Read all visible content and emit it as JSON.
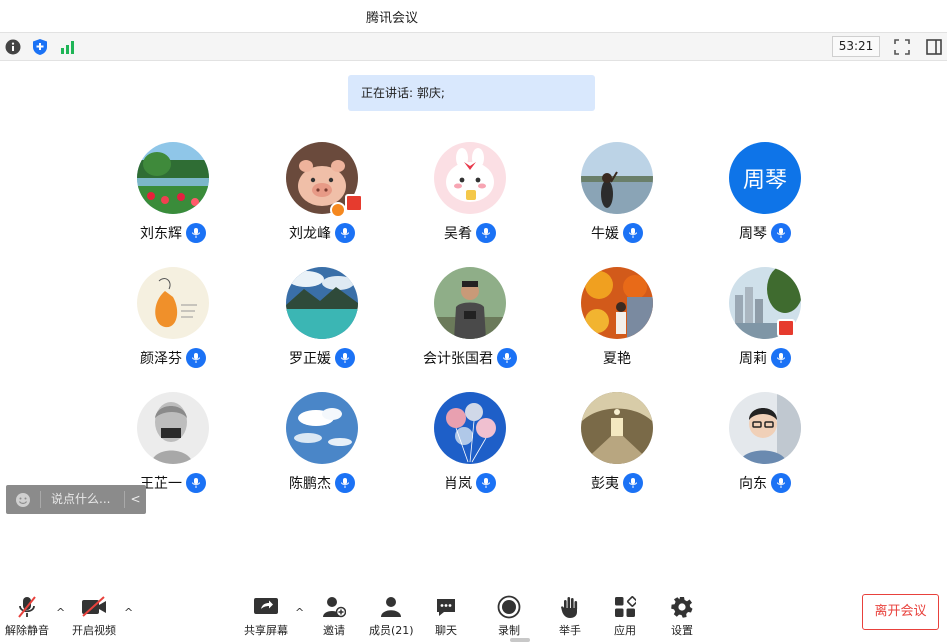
{
  "window": {
    "title": "腾讯会议"
  },
  "infobar": {
    "info_icon": "info-icon",
    "security_icon": "shield-icon",
    "signal_icon": "signal-icon",
    "timer": "53:21",
    "fullscreen_icon": "fullscreen-icon",
    "sidebar_icon": "sidebar-toggle-icon"
  },
  "speaking": {
    "text": "正在讲话: 郭庆;"
  },
  "participants": [
    {
      "name": "刘东辉",
      "avatar": "garden"
    },
    {
      "name": "刘龙峰",
      "avatar": "pig"
    },
    {
      "name": "吴肴",
      "avatar": "bunny"
    },
    {
      "name": "牛媛",
      "avatar": "lake-person"
    },
    {
      "name": "周琴",
      "avatar_text": "周琴",
      "avatar": "text"
    },
    {
      "name": "颜泽芬",
      "avatar": "sketch-balloon"
    },
    {
      "name": "罗正媛",
      "avatar": "mountain-lake"
    },
    {
      "name": "会计张国君",
      "avatar": "hiker"
    },
    {
      "name": "夏艳",
      "avatar": "autumn"
    },
    {
      "name": "周莉",
      "avatar": "city"
    },
    {
      "name": "王芷一",
      "avatar": "statue"
    },
    {
      "name": "陈鹏杰",
      "avatar": "clouds"
    },
    {
      "name": "肖岚",
      "avatar": "balloons"
    },
    {
      "name": "彭夷",
      "avatar": "metro"
    },
    {
      "name": "向东",
      "avatar": "glasses-man"
    }
  ],
  "chat": {
    "placeholder": "说点什么...",
    "collapse": "<"
  },
  "toolbar": {
    "unmute": "解除静音",
    "video": "开启视频",
    "share": "共享屏幕",
    "invite": "邀请",
    "members": "成员(21)",
    "chat": "聊天",
    "record": "录制",
    "raise_hand": "举手",
    "apps": "应用",
    "settings": "设置",
    "leave": "离开会议",
    "caret": "^"
  },
  "colors": {
    "accent": "#1b72f5",
    "leave": "#e8413c",
    "speaking_bg": "#d9e8fd"
  }
}
